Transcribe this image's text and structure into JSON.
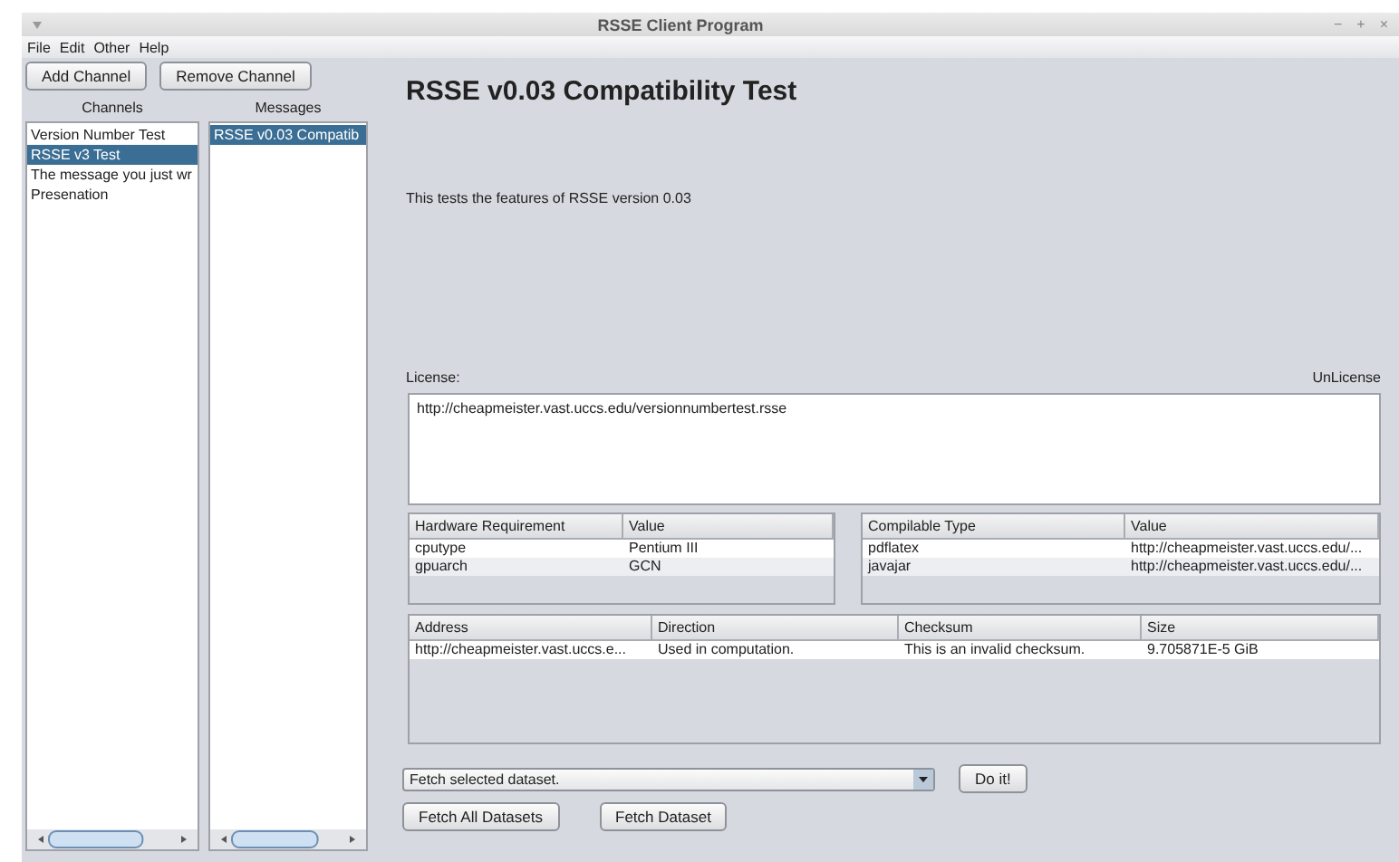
{
  "window": {
    "title": "RSSE Client Program",
    "controls": [
      "−",
      "+",
      "×"
    ]
  },
  "menu": [
    "File",
    "Edit",
    "Other",
    "Help"
  ],
  "toolbar": [
    "Add Channel",
    "Remove Channel"
  ],
  "channels": {
    "heading": "Channels",
    "items": [
      {
        "label": "Version Number Test",
        "selected": false
      },
      {
        "label": "RSSE v3 Test",
        "selected": true
      },
      {
        "label": "The message you just wr",
        "selected": false
      },
      {
        "label": "Presenation",
        "selected": false
      }
    ]
  },
  "messages": {
    "heading": "Messages",
    "items": [
      {
        "label": "RSSE v0.03 Compatib",
        "selected": true
      }
    ]
  },
  "detail": {
    "title": "RSSE v0.03 Compatibility Test",
    "description": "This tests the features of RSSE version 0.03",
    "license_label": "License:",
    "license_name": "UnLicense",
    "license_text": "http://cheapmeister.vast.uccs.edu/versionnumbertest.rsse"
  },
  "hardware_table": {
    "columns": [
      "Hardware Requirement",
      "Value"
    ],
    "rows": [
      [
        "cputype",
        "Pentium III"
      ],
      [
        "gpuarch",
        "GCN"
      ]
    ]
  },
  "compilable_table": {
    "columns": [
      "Compilable Type",
      "Value"
    ],
    "rows": [
      [
        "pdflatex",
        "http://cheapmeister.vast.uccs.edu/..."
      ],
      [
        "javajar",
        "http://cheapmeister.vast.uccs.edu/..."
      ]
    ]
  },
  "datasets_table": {
    "columns": [
      "Address",
      "Direction",
      "Checksum",
      "Size"
    ],
    "rows": [
      [
        "http://cheapmeister.vast.uccs.e...",
        "Used in computation.",
        "This is an invalid checksum.",
        "9.705871E-5 GiB"
      ]
    ]
  },
  "action": {
    "dropdown": "Fetch selected dataset.",
    "button": "Do it!"
  },
  "bottom_buttons": [
    "Fetch All Datasets",
    "Fetch Dataset"
  ]
}
